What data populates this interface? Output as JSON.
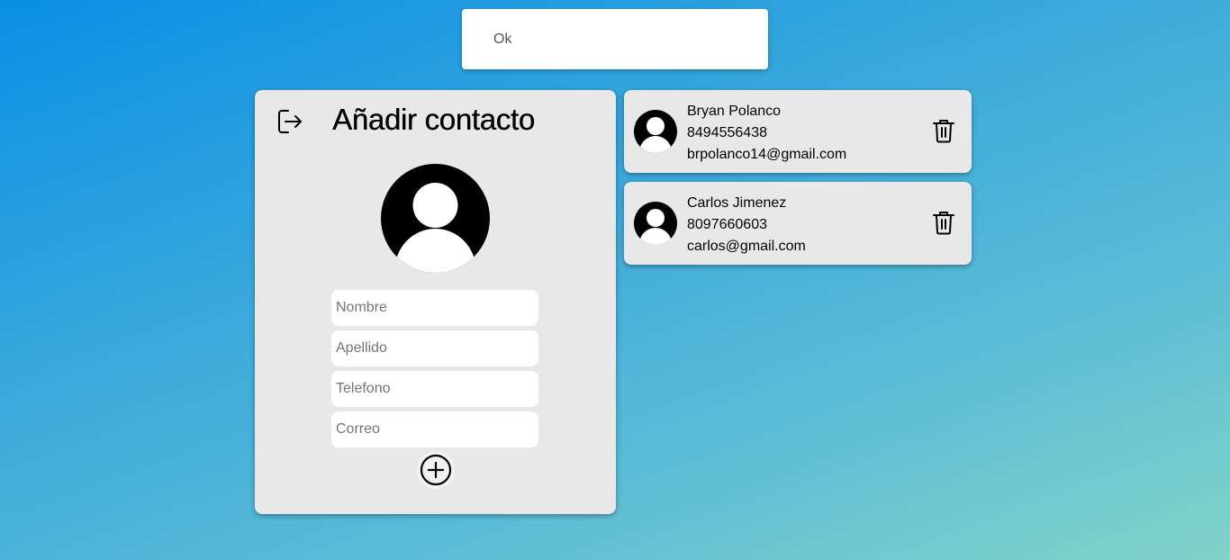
{
  "toast": {
    "message": "Ok"
  },
  "panel": {
    "title": "Añadir contacto",
    "logout_icon": "logout-icon",
    "avatar_icon": "user-avatar-icon",
    "fields": {
      "nombre_placeholder": "Nombre",
      "apellido_placeholder": "Apellido",
      "telefono_placeholder": "Telefono",
      "correo_placeholder": "Correo"
    },
    "add_icon": "plus-circle-icon"
  },
  "contacts": [
    {
      "name": "Bryan Polanco",
      "phone": "8494556438",
      "email": "brpolanco14@gmail.com"
    },
    {
      "name": "Carlos Jimenez",
      "phone": "8097660603",
      "email": "carlos@gmail.com"
    }
  ],
  "colors": {
    "background_start": "#0a8fe6",
    "background_end": "#82d3c8",
    "panel": "#e8e8e8"
  }
}
